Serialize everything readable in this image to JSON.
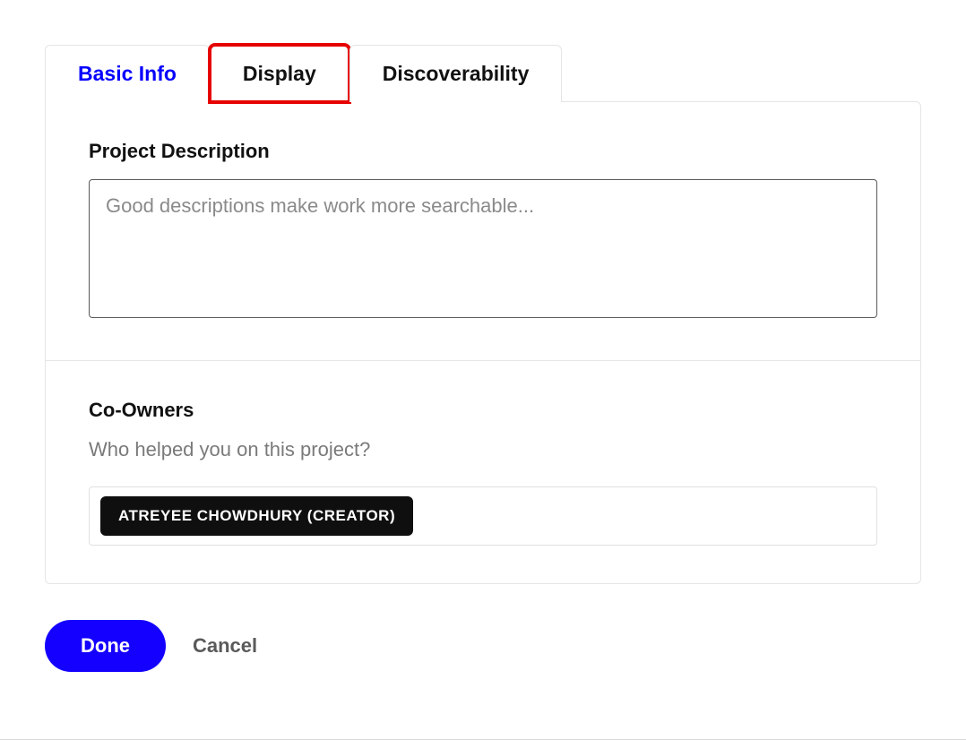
{
  "tabs": {
    "basic_info": "Basic Info",
    "display": "Display",
    "discoverability": "Discoverability"
  },
  "sections": {
    "description": {
      "label": "Project Description",
      "placeholder": "Good descriptions make work more searchable...",
      "value": ""
    },
    "coowners": {
      "label": "Co-Owners",
      "sublabel": "Who helped you on this project?",
      "chips": [
        "ATREYEE CHOWDHURY (CREATOR)"
      ]
    }
  },
  "actions": {
    "done": "Done",
    "cancel": "Cancel"
  }
}
